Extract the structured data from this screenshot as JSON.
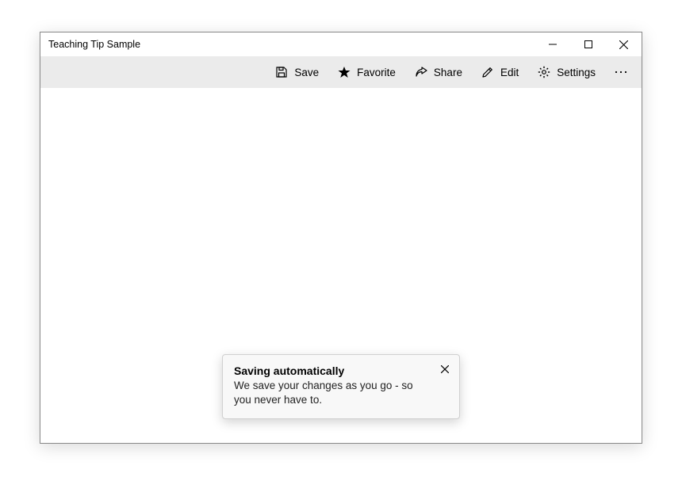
{
  "window": {
    "title": "Teaching Tip Sample"
  },
  "commandbar": {
    "save": "Save",
    "favorite": "Favorite",
    "share": "Share",
    "edit": "Edit",
    "settings": "Settings"
  },
  "teachingTip": {
    "title": "Saving automatically",
    "subtitle": "We save your changes as you go - so you never have to."
  }
}
